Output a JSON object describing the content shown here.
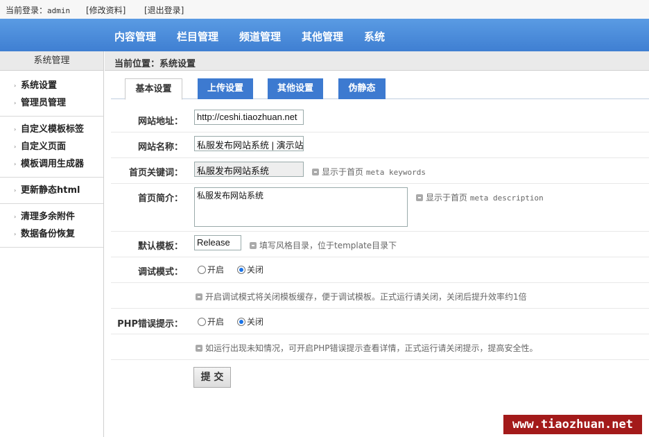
{
  "topbar": {
    "login_label": "当前登录：",
    "user": "admin",
    "edit_profile": "[修改资料]",
    "logout": "[退出登录]"
  },
  "nav": [
    "内容管理",
    "栏目管理",
    "频道管理",
    "其他管理",
    "系统"
  ],
  "sidebar": {
    "title": "系统管理",
    "groups": [
      [
        "系统设置",
        "管理员管理"
      ],
      [
        "自定义模板标签",
        "自定义页面",
        "模板调用生成器"
      ],
      [
        "更新静态html"
      ],
      [
        "清理多余附件",
        "数据备份恢复"
      ]
    ]
  },
  "breadcrumb": "当前位置：系统设置",
  "tabs": [
    "基本设置",
    "上传设置",
    "其他设置",
    "伪静态"
  ],
  "form": {
    "site_url_label": "网站地址：",
    "site_url_value": "http://ceshi.tiaozhuan.net",
    "site_name_label": "网站名称：",
    "site_name_value": "私服发布网站系统 | 演示站",
    "keywords_label": "首页关键词：",
    "keywords_value": "私服发布网站系统",
    "keywords_hint": "显示于首页",
    "keywords_hint_meta": "meta keywords",
    "desc_label": "首页简介：",
    "desc_value": "私服发布网站系统",
    "desc_hint": "显示于首页",
    "desc_hint_meta": "meta description",
    "template_label": "默认模板：",
    "template_value": "Release",
    "template_hint": "填写风格目录，位于template目录下",
    "debug_label": "调试模式：",
    "debug_on": "开启",
    "debug_off": "关闭",
    "debug_hint": "开启调试模式将关闭模板缓存，便于调试模板。正式运行请关闭，关闭后提升效率约1倍",
    "php_label": "PHP错误提示：",
    "php_on": "开启",
    "php_off": "关闭",
    "php_hint": "如运行出现未知情况，可开启PHP错误提示查看详情，正式运行请关闭提示，提高安全性。",
    "submit": "提 交"
  },
  "watermark": "www.tiaozhuan.net"
}
